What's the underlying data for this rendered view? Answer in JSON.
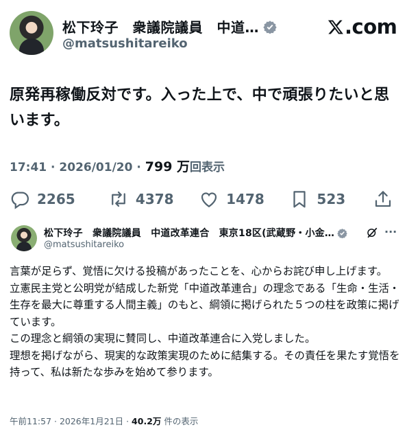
{
  "main": {
    "author_name": "松下玲子　衆議院議員　中道…",
    "handle": "@matsushitareiko",
    "brand": ".com",
    "text": "原発再稼働反対です。入った上で、中で頑張りたいと思います。",
    "time": "17:41 · 2026/01/20 · ",
    "views_count": "799 万",
    "views_label": "回表示",
    "replies": "2265",
    "retweets": "4378",
    "likes": "1478",
    "bookmarks": "523"
  },
  "quote": {
    "author_name": "松下玲子　衆議院議員　中道改革連合　東京18区(武蔵野・小金…",
    "handle": "@matsushitareiko",
    "more": "···",
    "lines": [
      "言葉が足らず、覚悟に欠ける投稿があったことを、心からお詫び申し上げます。",
      "立憲民主党と公明党が結成した新党「中道改革連合」の理念である「生命・生活・生存を最大に尊重する人間主義」のもと、綱領に掲げられた５つの柱を政策に掲げています。",
      "この理念と綱領の実現に賛同し、中道改革連合に入党しました。",
      "理想を掲げながら、現実的な政策実現のために結集する。その責任を果たす覚悟を持って、私は新たな歩みを始めて参ります。"
    ],
    "time": "午前11:57 · 2026年1月21日 · ",
    "views_count": "40.2万",
    "views_label": " 件の表示"
  },
  "colors": {
    "verified": "#1d9bf0",
    "muted": "#536471",
    "text": "#0f1419"
  },
  "icons": [
    "verified-badge-icon",
    "x-logo-icon",
    "reply-icon",
    "retweet-icon",
    "like-icon",
    "bookmark-icon",
    "share-icon",
    "grok-icon"
  ]
}
